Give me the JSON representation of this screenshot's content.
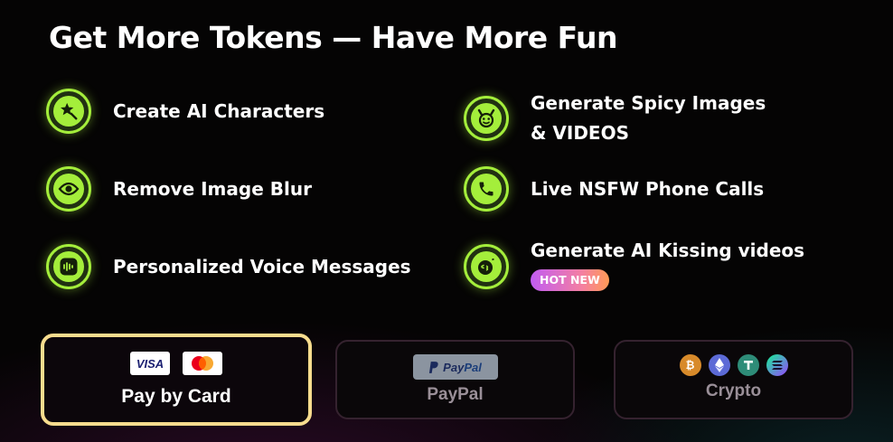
{
  "title": "Get More Tokens — Have More Fun",
  "colors": {
    "accent": "#a4ee3b",
    "selected_border": "#f7dc8e"
  },
  "features": [
    {
      "icon": "sparkle-magic-icon",
      "label": "Create AI Characters"
    },
    {
      "icon": "devil-face-icon",
      "label_line1": "Generate Spicy Images",
      "label_line2": "& VIDEOS"
    },
    {
      "icon": "eye-icon",
      "label": "Remove Image Blur"
    },
    {
      "icon": "phone-icon",
      "label": "Live NSFW Phone Calls"
    },
    {
      "icon": "voice-waveform-icon",
      "label": "Personalized Voice Messages"
    },
    {
      "icon": "kiss-face-icon",
      "label": "Generate AI Kissing videos",
      "badge": "HOT NEW"
    }
  ],
  "payment_methods": [
    {
      "label": "Pay by Card",
      "selected": true,
      "logos": {
        "visa": "VISA"
      }
    },
    {
      "label": "PayPal",
      "selected": false,
      "logo_text": "PayPal"
    },
    {
      "label": "Crypto",
      "selected": false,
      "coins": [
        "bitcoin-icon",
        "ethereum-icon",
        "tether-icon",
        "solana-icon"
      ]
    }
  ]
}
